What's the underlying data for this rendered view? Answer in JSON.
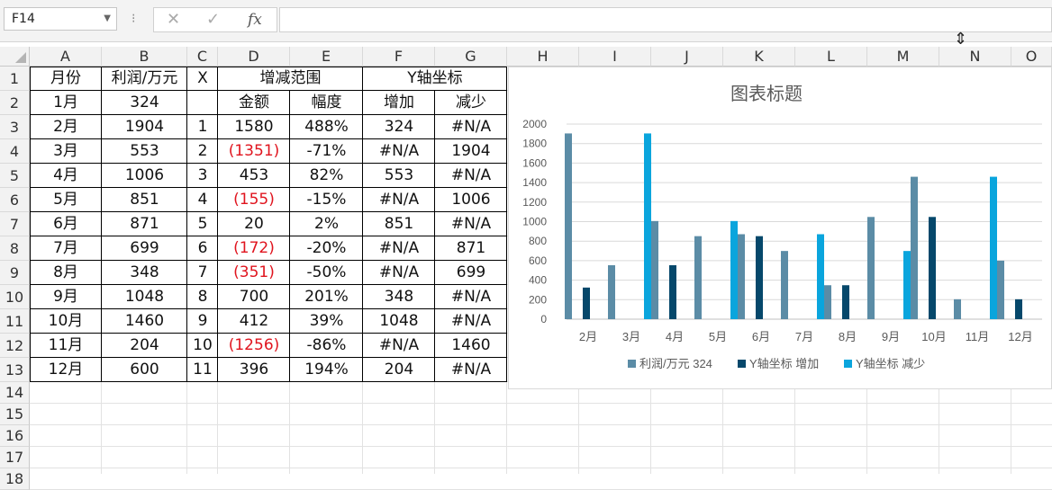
{
  "name_box": {
    "value": "F14"
  },
  "formula_bar": {
    "cancel_label": "✕",
    "enter_label": "✓",
    "fx_label": "fx",
    "value": ""
  },
  "columns": [
    "A",
    "B",
    "C",
    "D",
    "E",
    "F",
    "G",
    "H",
    "I",
    "J",
    "K",
    "L",
    "M",
    "N",
    "O"
  ],
  "rows": [
    "1",
    "2",
    "3",
    "4",
    "5",
    "6",
    "7",
    "8",
    "9",
    "10",
    "11",
    "12",
    "13",
    "14",
    "15",
    "16",
    "17",
    "18"
  ],
  "header_row1": {
    "a": "月份",
    "b": "利润/万元",
    "c": "X",
    "de": "增减范围",
    "fg": "Y轴坐标"
  },
  "header_row2": {
    "a": "1月",
    "b": "324",
    "c": "",
    "d": "金额",
    "e": "幅度",
    "f": "增加",
    "g": "减少"
  },
  "data_rows": [
    [
      "2月",
      "1904",
      "1",
      "1580",
      "488%",
      "324",
      "#N/A"
    ],
    [
      "3月",
      "553",
      "2",
      "(1351)",
      "-71%",
      "#N/A",
      "1904"
    ],
    [
      "4月",
      "1006",
      "3",
      "453",
      "82%",
      "553",
      "#N/A"
    ],
    [
      "5月",
      "851",
      "4",
      "(155)",
      "-15%",
      "#N/A",
      "1006"
    ],
    [
      "6月",
      "871",
      "5",
      "20",
      "2%",
      "851",
      "#N/A"
    ],
    [
      "7月",
      "699",
      "6",
      "(172)",
      "-20%",
      "#N/A",
      "871"
    ],
    [
      "8月",
      "348",
      "7",
      "(351)",
      "-50%",
      "#N/A",
      "699"
    ],
    [
      "9月",
      "1048",
      "8",
      "700",
      "201%",
      "348",
      "#N/A"
    ],
    [
      "10月",
      "1460",
      "9",
      "412",
      "39%",
      "1048",
      "#N/A"
    ],
    [
      "11月",
      "204",
      "10",
      "(1256)",
      "-86%",
      "#N/A",
      "1460"
    ],
    [
      "12月",
      "600",
      "11",
      "396",
      "194%",
      "204",
      "#N/A"
    ]
  ],
  "colors": {
    "neg_text": "#e0141e",
    "series1": "#5b8ca6",
    "series2": "#06486b",
    "series3": "#0aa5dd",
    "grid": "#d9d9d9",
    "axis_text": "#595959"
  },
  "chart_data": {
    "type": "bar",
    "title": "图表标题",
    "categories": [
      "2月",
      "3月",
      "4月",
      "5月",
      "6月",
      "7月",
      "8月",
      "9月",
      "10月",
      "11月",
      "12月"
    ],
    "series": [
      {
        "name": "利润/万元 324",
        "values": [
          1904,
          553,
          1006,
          851,
          871,
          699,
          348,
          1048,
          1460,
          204,
          600
        ]
      },
      {
        "name": "Y轴坐标 增加",
        "values": [
          324,
          null,
          553,
          null,
          851,
          null,
          348,
          null,
          1048,
          null,
          204
        ]
      },
      {
        "name": "Y轴坐标 减少",
        "values": [
          null,
          1904,
          null,
          1006,
          null,
          871,
          null,
          699,
          null,
          1460,
          null
        ]
      }
    ],
    "ylim": [
      0,
      2000
    ],
    "yticks": [
      "0",
      "200",
      "400",
      "600",
      "800",
      "1000",
      "1200",
      "1400",
      "1600",
      "1800",
      "2000"
    ],
    "grid": true,
    "legend": "bottom"
  }
}
